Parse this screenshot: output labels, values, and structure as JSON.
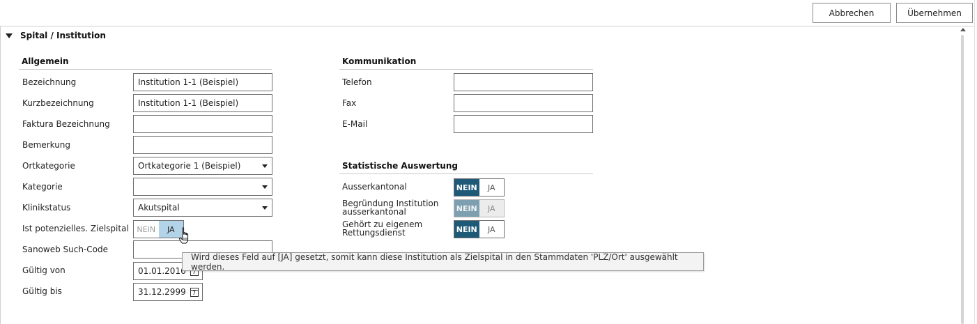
{
  "toolbar": {
    "cancel_label": "Abbrechen",
    "apply_label": "Übernehmen"
  },
  "section": {
    "title": "Spital / Institution"
  },
  "allgemein": {
    "title": "Allgemein",
    "fields": {
      "bezeichnung": {
        "label": "Bezeichnung",
        "value": "Institution 1-1 (Beispiel)"
      },
      "kurzbezeichnung": {
        "label": "Kurzbezeichnung",
        "value": "Institution 1-1 (Beispiel)"
      },
      "faktura": {
        "label": "Faktura Bezeichnung",
        "value": ""
      },
      "bemerkung": {
        "label": "Bemerkung",
        "value": ""
      },
      "ortkategorie": {
        "label": "Ortkategorie",
        "value": "Ortkategorie 1 (Beispiel)"
      },
      "kategorie": {
        "label": "Kategorie",
        "value": ""
      },
      "klinikstatus": {
        "label": "Klinikstatus",
        "value": "Akutspital"
      },
      "zielspital": {
        "label": "Ist potenzielles. Zielspital",
        "no": "NEIN",
        "yes": "JA",
        "selected": "JA"
      },
      "sanoweb": {
        "label": "Sanoweb Such-Code",
        "value": ""
      },
      "gueltig_von": {
        "label": "Gültig von",
        "value": "01.01.2016"
      },
      "gueltig_bis": {
        "label": "Gültig bis",
        "value": "31.12.2999"
      }
    }
  },
  "kommunikation": {
    "title": "Kommunikation",
    "fields": {
      "telefon": {
        "label": "Telefon",
        "value": ""
      },
      "fax": {
        "label": "Fax",
        "value": ""
      },
      "email": {
        "label": "E-Mail",
        "value": ""
      }
    }
  },
  "statistik": {
    "title": "Statistische Auswertung",
    "fields": {
      "ausserkantonal": {
        "label": "Ausserkantonal",
        "no": "NEIN",
        "yes": "JA",
        "selected": "NEIN"
      },
      "begruendung": {
        "label": "Begründung Institution ausserkantonal",
        "no": "NEIN",
        "yes": "JA",
        "selected": "NEIN",
        "disabled": true
      },
      "rettungsdienst": {
        "label": "Gehört zu eigenem Rettungsdienst",
        "no": "NEIN",
        "yes": "JA",
        "selected": "NEIN"
      }
    }
  },
  "tooltip": {
    "text": "Wird dieses Feld auf [JA] gesetzt, somit kann diese Institution als Zielspital in den Stammdaten 'PLZ/Ort' ausgewählt werden."
  },
  "calendar_icon_glyph": "7",
  "colors": {
    "toggle_active": "#1e5a78",
    "toggle_hover": "#b3d4e8",
    "toggle_disabled_active": "#7d9fb0"
  }
}
